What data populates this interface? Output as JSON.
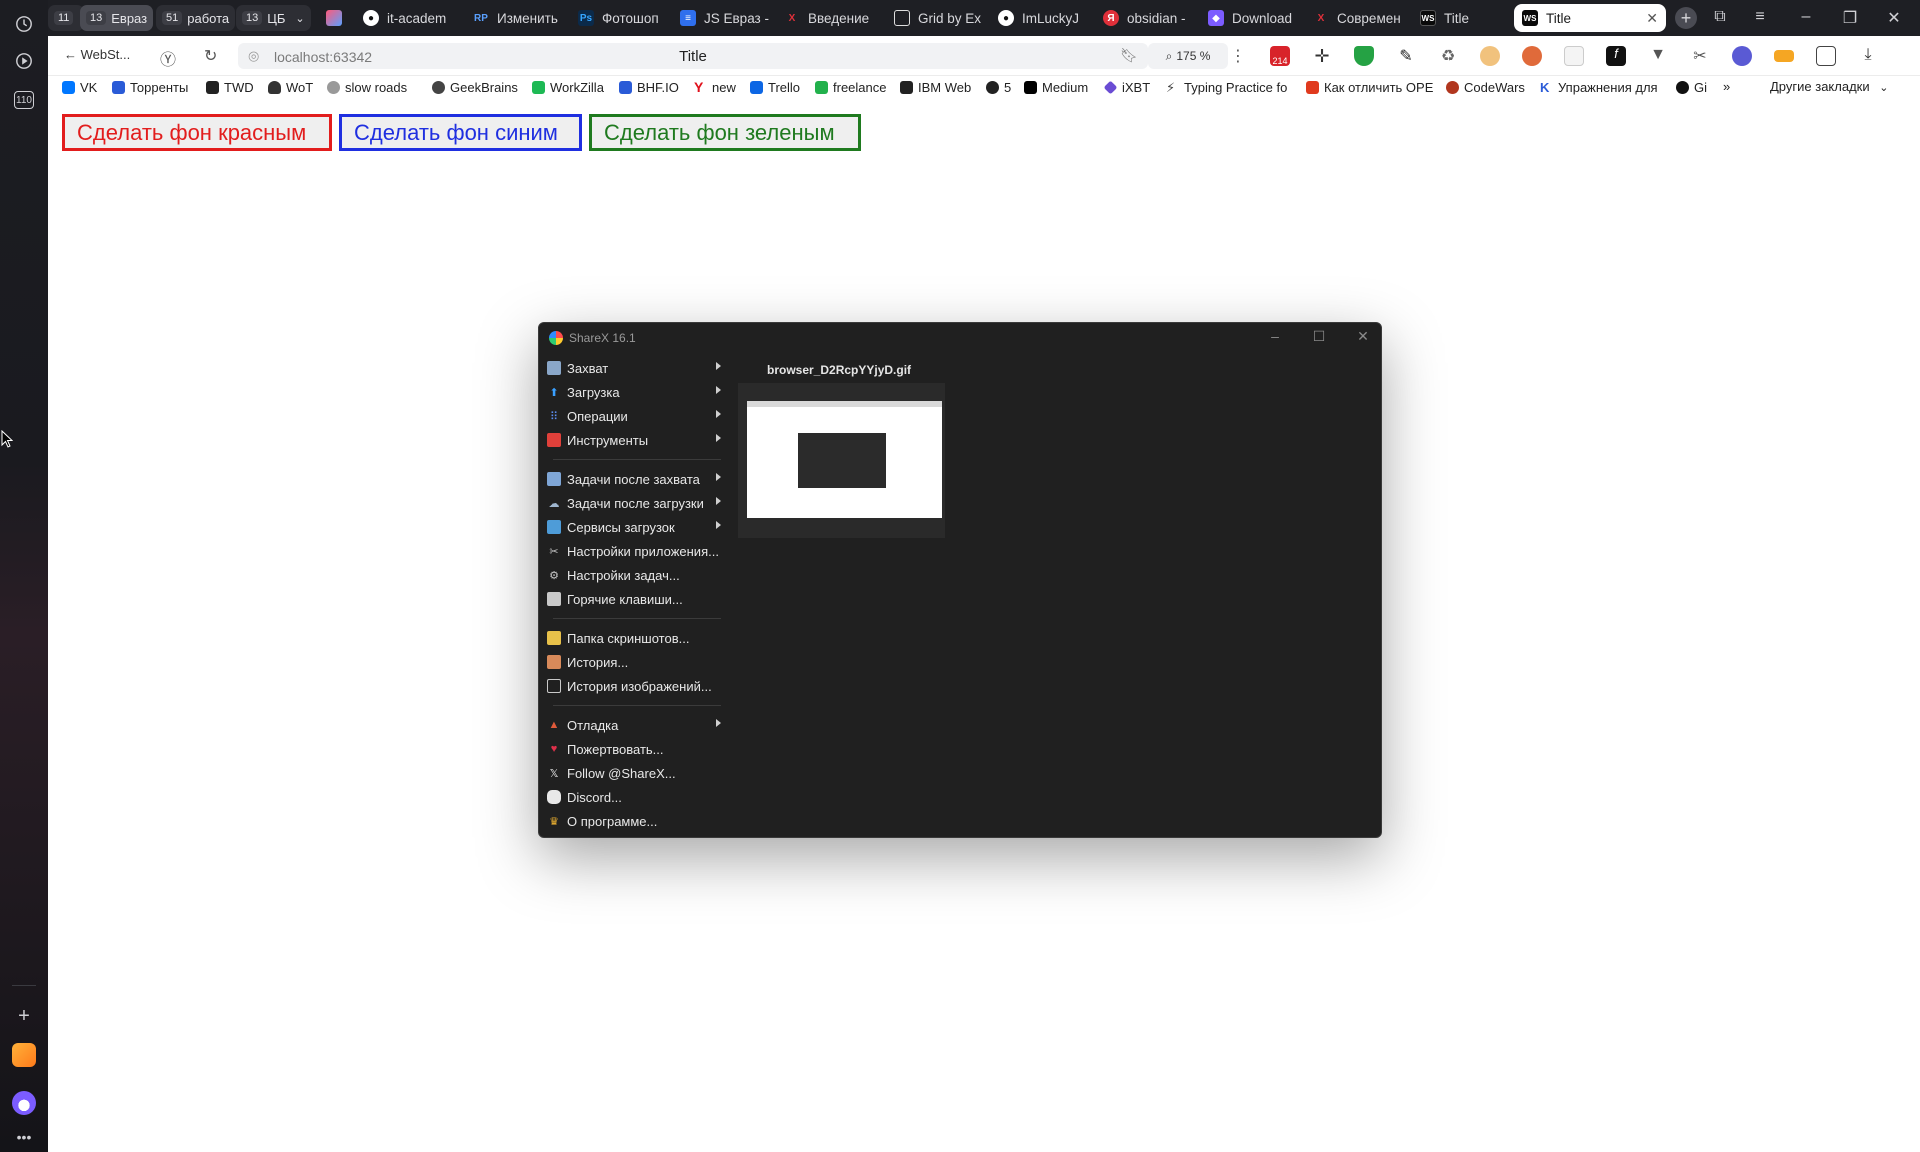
{
  "tabstrip": {
    "groups": [
      {
        "count": "11",
        "label": ""
      },
      {
        "count": "13",
        "label": "Евраз"
      },
      {
        "count": "51",
        "label": "работа"
      },
      {
        "count": "13",
        "label": "ЦБ"
      }
    ],
    "tabs": [
      {
        "label": "it-academ",
        "icon": "github-icon"
      },
      {
        "label": "Изменить",
        "icon": "rp-icon"
      },
      {
        "label": "Фотошоп",
        "icon": "ps-icon"
      },
      {
        "label": "JS Евраз -",
        "icon": "docs-icon"
      },
      {
        "label": "Введение",
        "icon": "x-icon"
      },
      {
        "label": "Grid by Ex",
        "icon": "doc-icon"
      },
      {
        "label": "ImLuckyJ",
        "icon": "github-icon"
      },
      {
        "label": "obsidian -",
        "icon": "yandex-icon"
      },
      {
        "label": "Download",
        "icon": "obsidian-icon"
      },
      {
        "label": "Современ",
        "icon": "x-icon"
      },
      {
        "label": "Title",
        "icon": "webstorm-icon"
      }
    ],
    "active_tab": {
      "label": "Title",
      "icon": "webstorm-icon"
    }
  },
  "sidebar": {
    "badge": "110"
  },
  "addressbar": {
    "back_label": "WebSt...",
    "url": "localhost:63342",
    "page_title": "Title",
    "zoom": "175 %",
    "ext_badge": "214"
  },
  "bookmarks": {
    "items": [
      {
        "label": "VK",
        "color": "#0077ff"
      },
      {
        "label": "Торренты",
        "color": "#2a5bd7"
      },
      {
        "label": "TWD",
        "color": "#222222"
      },
      {
        "label": "WoT",
        "color": "#333333"
      },
      {
        "label": "slow roads",
        "color": "#777777"
      },
      {
        "label": "GeekBrains",
        "color": "#444444"
      },
      {
        "label": "WorkZilla",
        "color": "#1db954"
      },
      {
        "label": "BHF.IO",
        "color": "#2a5bd7"
      },
      {
        "label": "new",
        "color": "#e0101b"
      },
      {
        "label": "Trello",
        "color": "#0c66e4"
      },
      {
        "label": "freelance",
        "color": "#22b14c"
      },
      {
        "label": "IBM Web",
        "color": "#222222"
      },
      {
        "label": "5",
        "color": "#222222"
      },
      {
        "label": "Medium",
        "color": "#000000"
      },
      {
        "label": "iXBT",
        "color": "#6a4cd4"
      },
      {
        "label": "Typing Practice fo",
        "color": "#444444"
      },
      {
        "label": "Как отличить OPE",
        "color": "#e03a1e"
      },
      {
        "label": "CodeWars",
        "color": "#b1361e"
      },
      {
        "label": "Упражнения для",
        "color": "#2a5bd7"
      },
      {
        "label": "Gi",
        "color": "#111111"
      }
    ],
    "more_label": "»",
    "other_label": "Другие закладки"
  },
  "page": {
    "buttons": {
      "red": "Сделать фон красным",
      "blue": "Сделать фон синим",
      "green": "Сделать фон зеленым"
    }
  },
  "sharex": {
    "title": "ShareX 16.1",
    "menu": [
      {
        "label": "Захват",
        "submenu": true,
        "icon": "capture-icon",
        "color": "#8aa7c9"
      },
      {
        "label": "Загрузка",
        "submenu": true,
        "icon": "upload-icon",
        "color": "#3aa0ff"
      },
      {
        "label": "Операции",
        "submenu": true,
        "icon": "workflows-icon",
        "color": "#5b8df0"
      },
      {
        "label": "Инструменты",
        "submenu": true,
        "icon": "tools-icon",
        "color": "#e0403a"
      },
      {
        "label": "Задачи после захвата",
        "submenu": true,
        "icon": "after-capture-icon",
        "color": "#7fa6d6"
      },
      {
        "label": "Задачи после загрузки",
        "submenu": true,
        "icon": "after-upload-icon",
        "color": "#9fb6cf"
      },
      {
        "label": "Сервисы загрузок",
        "submenu": true,
        "icon": "destinations-icon",
        "color": "#4e9cd8"
      },
      {
        "label": "Настройки приложения...",
        "submenu": false,
        "icon": "app-settings-icon",
        "color": "#c9c9c9"
      },
      {
        "label": "Настройки задач...",
        "submenu": false,
        "icon": "task-settings-icon",
        "color": "#c9c9c9"
      },
      {
        "label": "Горячие клавиши...",
        "submenu": false,
        "icon": "hotkeys-icon",
        "color": "#c9c9c9"
      },
      {
        "label": "Папка скриншотов...",
        "submenu": false,
        "icon": "folder-icon",
        "color": "#e8c14a"
      },
      {
        "label": "История...",
        "submenu": false,
        "icon": "history-icon",
        "color": "#d88a5a"
      },
      {
        "label": "История изображений...",
        "submenu": false,
        "icon": "image-history-icon",
        "color": "#c9c9c9"
      },
      {
        "label": "Отладка",
        "submenu": true,
        "icon": "debug-icon",
        "color": "#e05a3a"
      },
      {
        "label": "Пожертвовать...",
        "submenu": false,
        "icon": "heart-icon",
        "color": "#e0304a"
      },
      {
        "label": "Follow @ShareX...",
        "submenu": false,
        "icon": "x-logo-icon",
        "color": "#e8e8e8"
      },
      {
        "label": "Discord...",
        "submenu": false,
        "icon": "discord-icon",
        "color": "#e8e8e8"
      },
      {
        "label": "О программе...",
        "submenu": false,
        "icon": "crown-icon",
        "color": "#f2b531"
      }
    ],
    "file_name": "browser_D2RcpYYjyD.gif"
  }
}
